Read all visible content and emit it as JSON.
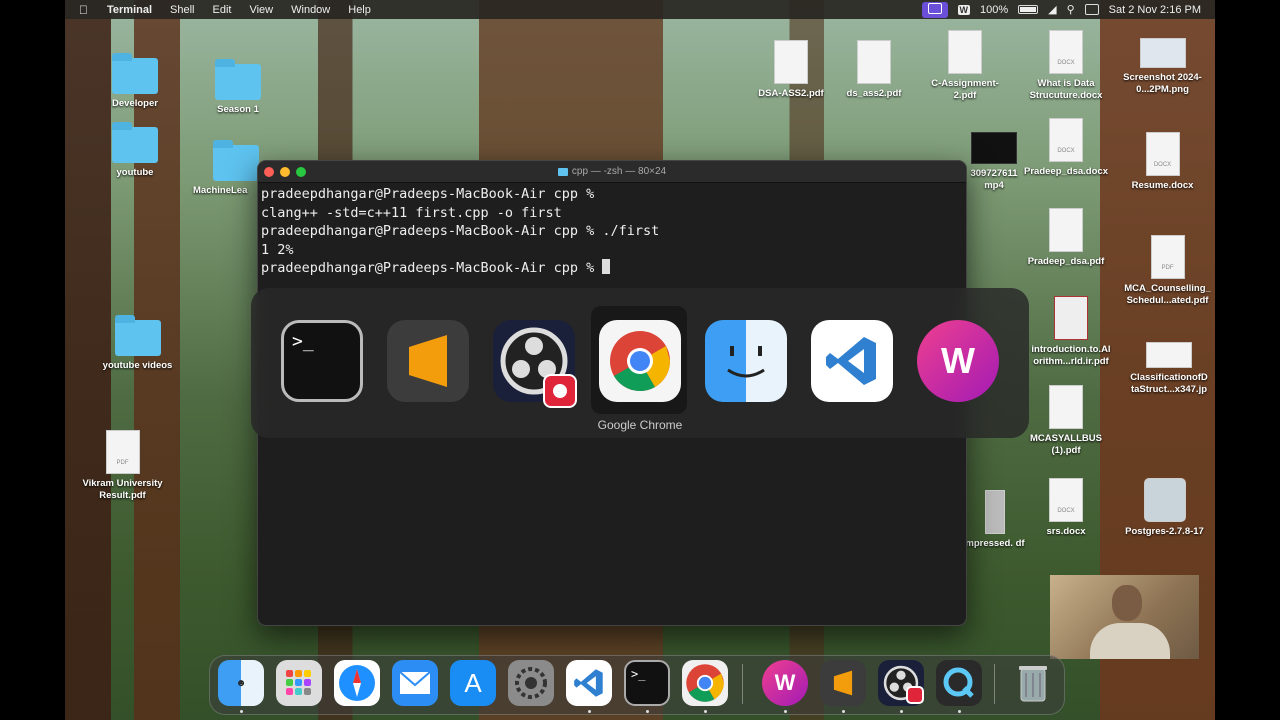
{
  "menubar": {
    "app": "Terminal",
    "items": [
      "Shell",
      "Edit",
      "View",
      "Window",
      "Help"
    ],
    "battery": "100%",
    "datetime": "Sat 2 Nov  2:16 PM"
  },
  "desktop": {
    "left_items": [
      "Developer",
      "Season 1",
      "youtube",
      "MachineLea",
      "youtube videos",
      "Vikram University Result.pdf"
    ],
    "right_items": [
      "DSA-ASS2.pdf",
      "ds_ass2.pdf",
      "C-Assignment-2.pdf",
      "What is Data Strucuture.docx",
      "Screenshot 2024-0...2PM.png",
      "Pradeep_dsa.docx",
      "Resume.docx",
      "309727611 mp4",
      "Pradeep_dsa.pdf",
      "MCA_Counselling_ Schedul...ated.pdf",
      "introduction.to.Al orithm...rld.ir.pdf",
      "ClassificationofD taStruct...x347.jp",
      "MCASYALLBUS (1).pdf",
      "srs.docx",
      "Postgres-2.7.8-17",
      "mpressed. df"
    ]
  },
  "terminal": {
    "title": "cpp — -zsh — 80×24",
    "lines": [
      "pradeepdhangar@Pradeeps-MacBook-Air cpp %",
      "clang++ -std=c++11 first.cpp -o first",
      "pradeepdhangar@Pradeeps-MacBook-Air cpp % ./first",
      "1 2%",
      "pradeepdhangar@Pradeeps-MacBook-Air cpp % "
    ]
  },
  "switcher": {
    "apps": [
      "Terminal",
      "Sublime Text",
      "OBS",
      "Google Chrome",
      "Finder",
      "Visual Studio Code",
      "WPS Office"
    ],
    "selected_label": "Google Chrome"
  },
  "dock": {
    "apps": [
      "Finder",
      "Launchpad",
      "Safari",
      "Mail",
      "App Store",
      "System Settings",
      "Visual Studio Code",
      "Terminal",
      "Google Chrome",
      "WPS Office",
      "Sublime Text",
      "OBS",
      "QuickTime Player",
      "Trash"
    ]
  },
  "colors": {
    "menubar_highlight": "#6c4fd8",
    "folder": "#5ec3ef",
    "terminal_bg": "#1e1e1e",
    "sublime_orange": "#f49d0c",
    "vscode_blue": "#2f80d1",
    "wps_pink": "#d42a8c"
  }
}
